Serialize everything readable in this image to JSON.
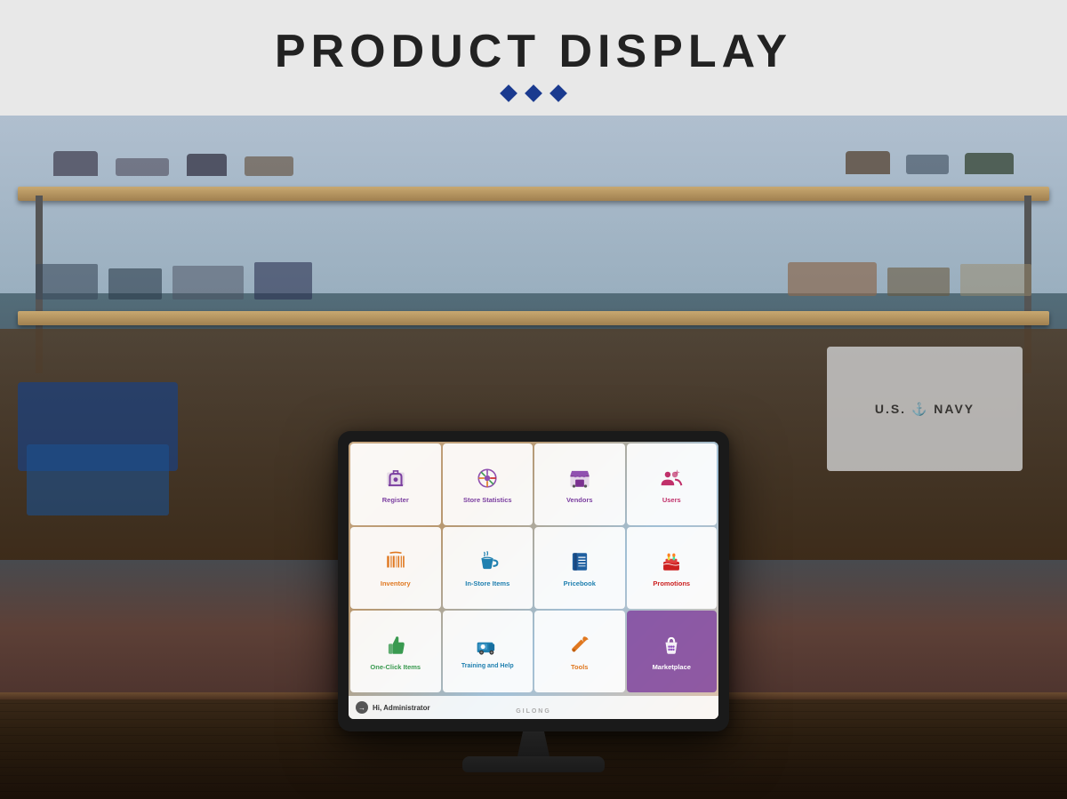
{
  "header": {
    "title": "PRODUCT DISPLAY",
    "diamonds": [
      "◆",
      "◆",
      "◆"
    ]
  },
  "monitor": {
    "brand": "GILONG",
    "statusbar": {
      "icon": "→",
      "text": "Hi, Administrator"
    }
  },
  "tiles": [
    {
      "id": "register",
      "label": "Register",
      "color": "purple",
      "iconColor": "#7b3fa0"
    },
    {
      "id": "store-statistics",
      "label": "Store Statistics",
      "color": "purple",
      "iconColor": "#9050b0"
    },
    {
      "id": "vendors",
      "label": "Vendors",
      "color": "purple",
      "iconColor": "#9050b0"
    },
    {
      "id": "users",
      "label": "Users",
      "color": "magenta",
      "iconColor": "#c0306a"
    },
    {
      "id": "inventory",
      "label": "Inventory",
      "color": "orange",
      "iconColor": "#e07820"
    },
    {
      "id": "in-store-items",
      "label": "In-Store Items",
      "color": "teal",
      "iconColor": "#2080b0"
    },
    {
      "id": "pricebook",
      "label": "Pricebook",
      "color": "teal",
      "iconColor": "#2060a0"
    },
    {
      "id": "promotions",
      "label": "Promotions",
      "color": "red",
      "iconColor": "#cc2020"
    },
    {
      "id": "one-click-items",
      "label": "One-Click Items",
      "color": "green",
      "iconColor": "#3a9a50"
    },
    {
      "id": "training-and-help",
      "label": "Training and Help",
      "color": "teal",
      "iconColor": "#2080b0"
    },
    {
      "id": "tools",
      "label": "Tools",
      "color": "orange",
      "iconColor": "#e07820"
    },
    {
      "id": "marketplace",
      "label": "Marketplace",
      "color": "white",
      "iconColor": "#ffffff"
    }
  ]
}
